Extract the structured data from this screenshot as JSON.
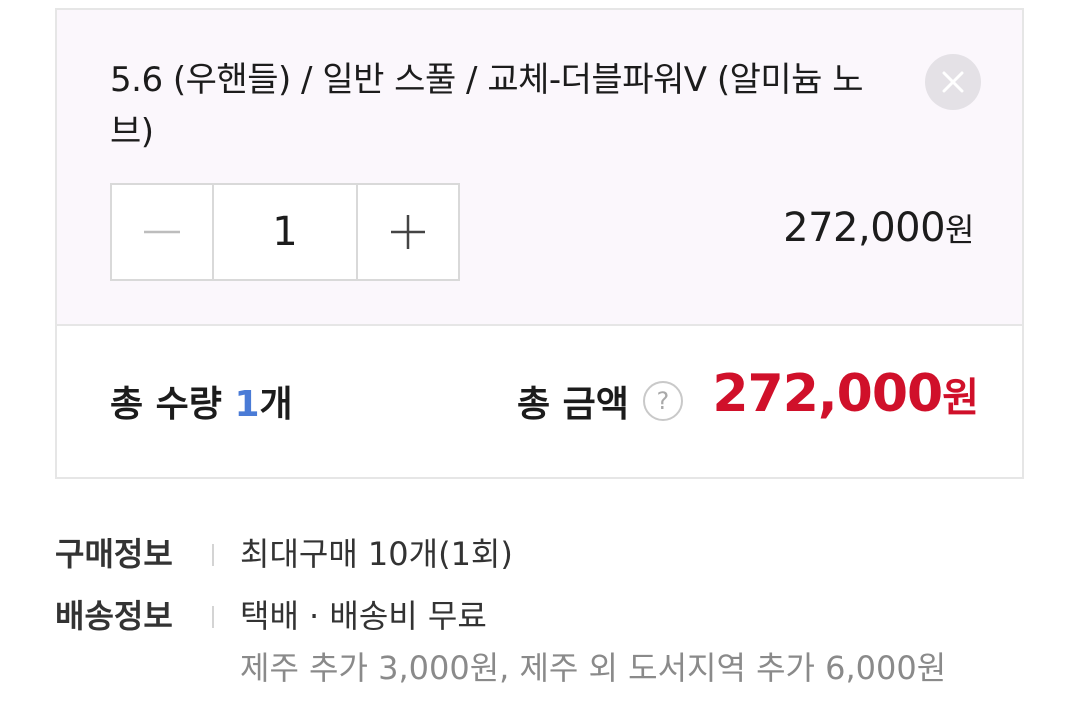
{
  "option": {
    "title": "5.6 (우핸들) / 일반 스풀 / 교체-더블파워V (알미늄 노브)",
    "quantity": "1",
    "price": "272,000",
    "price_unit": "원"
  },
  "total": {
    "qty_label": "총 수량 ",
    "qty_value": "1",
    "qty_unit": "개",
    "amount_label": "총 금액",
    "help_symbol": "?",
    "amount": "272,000",
    "amount_unit": "원"
  },
  "info": {
    "purchase_label": "구매정보",
    "purchase_value": "최대구매 10개(1회)",
    "shipping_label": "배송정보",
    "shipping_value": "택배 · 배송비 무료",
    "shipping_extra": "제주 추가 3,000원, 제주 외 도서지역 추가 6,000원"
  },
  "colors": {
    "accent_red": "#d0102a",
    "qty_blue": "#4a7bd6",
    "option_bg": "#fbf7fc"
  },
  "icons": [
    "close-icon",
    "minus-icon",
    "plus-icon",
    "help-icon"
  ]
}
